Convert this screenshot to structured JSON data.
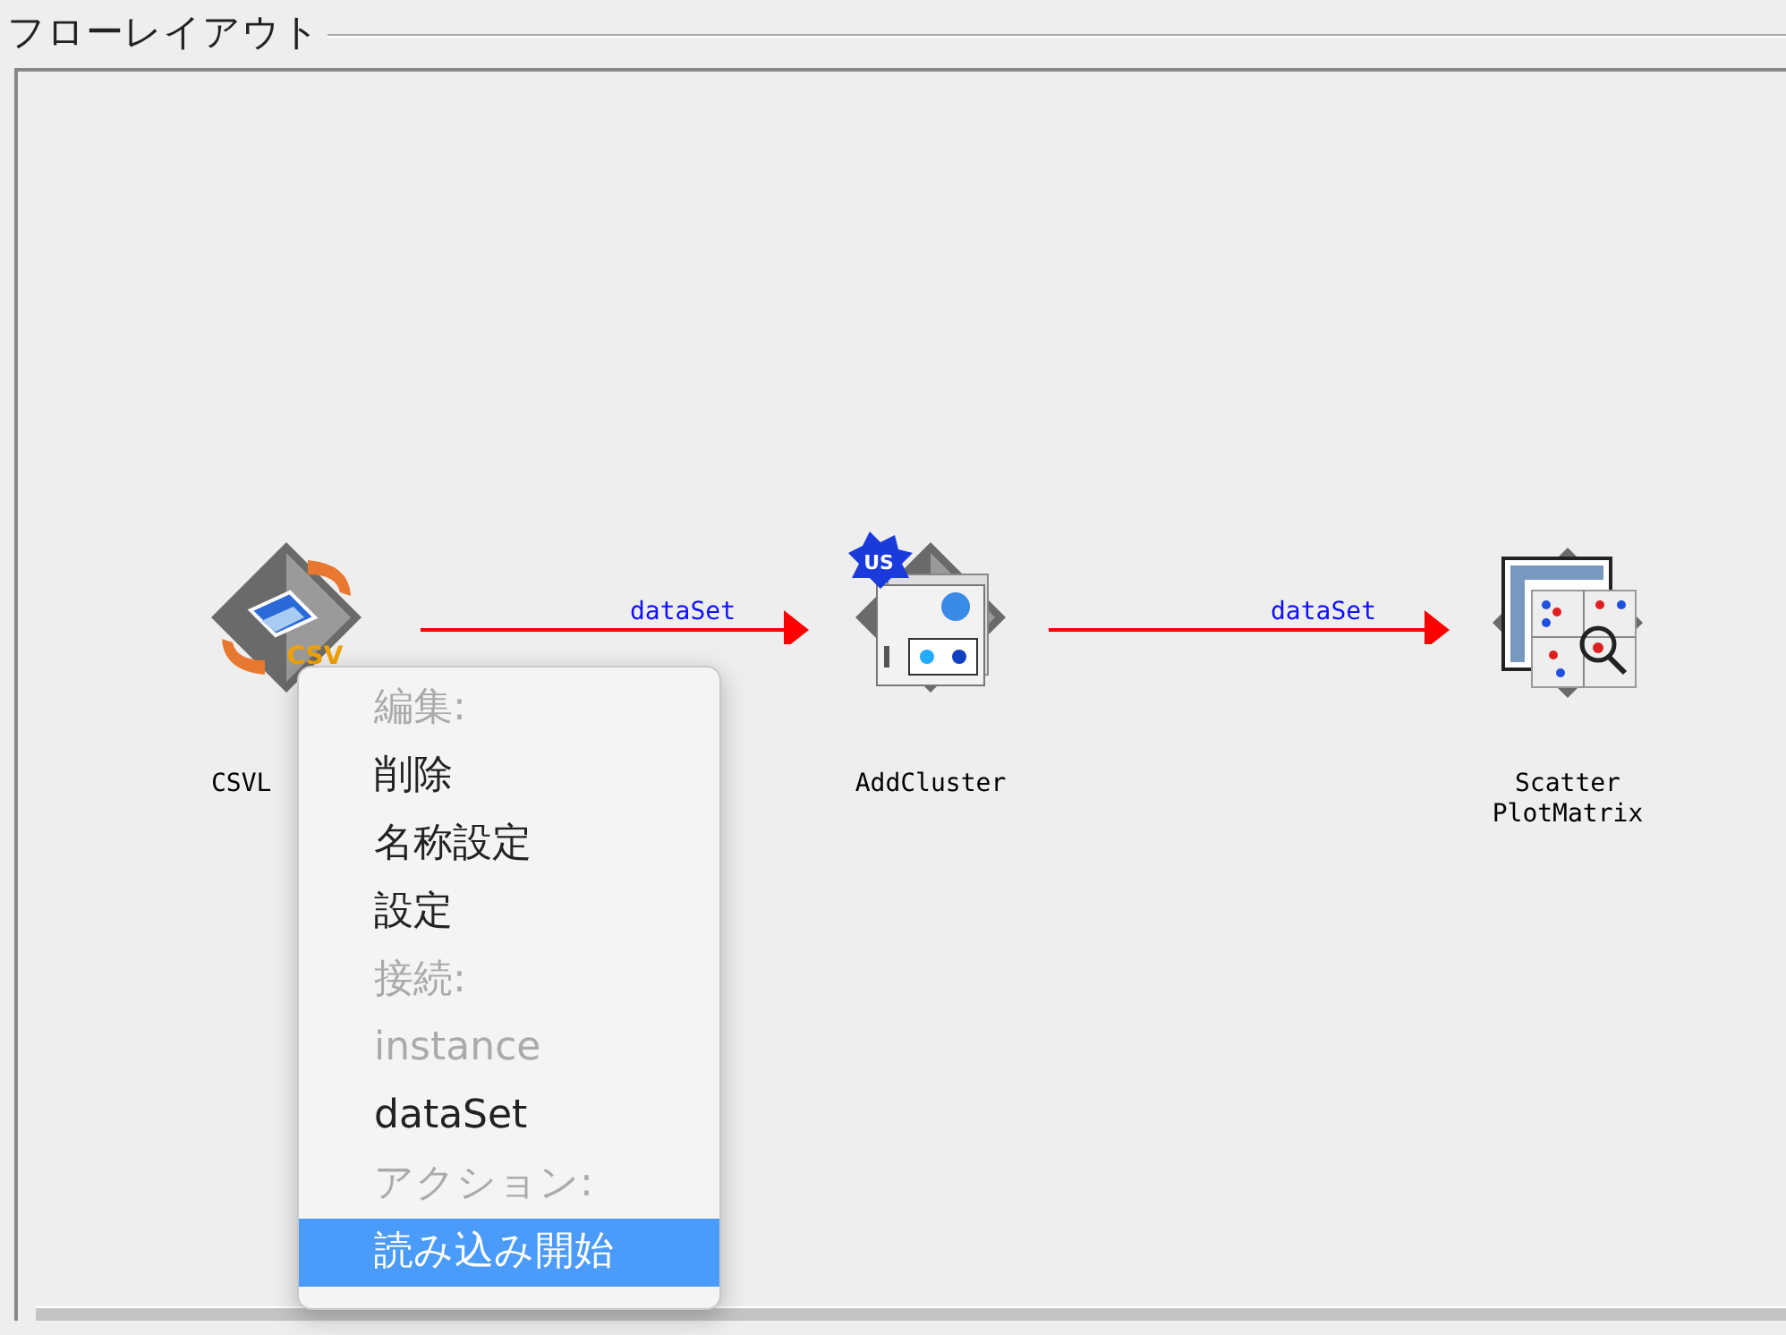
{
  "panel": {
    "title": "フローレイアウト"
  },
  "nodes": [
    {
      "kind": "csv",
      "badge": "CSV",
      "label_lines": [
        "CSVL"
      ]
    },
    {
      "kind": "cluster",
      "badge": "US",
      "label_lines": [
        "AddCluster"
      ]
    },
    {
      "kind": "scatter",
      "label_lines": [
        "Scatter",
        "PlotMatrix"
      ]
    }
  ],
  "edges": [
    {
      "label": "dataSet"
    },
    {
      "label": "dataSet"
    }
  ],
  "context_menu": {
    "items": [
      {
        "kind": "header",
        "text": "編集:",
        "selected": false
      },
      {
        "kind": "item",
        "text": "削除",
        "selected": false
      },
      {
        "kind": "item",
        "text": "名称設定",
        "selected": false
      },
      {
        "kind": "item",
        "text": "設定",
        "selected": false
      },
      {
        "kind": "header",
        "text": "接続:",
        "selected": false
      },
      {
        "kind": "disabled",
        "text": "instance",
        "selected": false
      },
      {
        "kind": "item",
        "text": "dataSet",
        "selected": false
      },
      {
        "kind": "header",
        "text": "アクション:",
        "selected": false
      },
      {
        "kind": "item",
        "text": "読み込み開始",
        "selected": true
      }
    ]
  }
}
